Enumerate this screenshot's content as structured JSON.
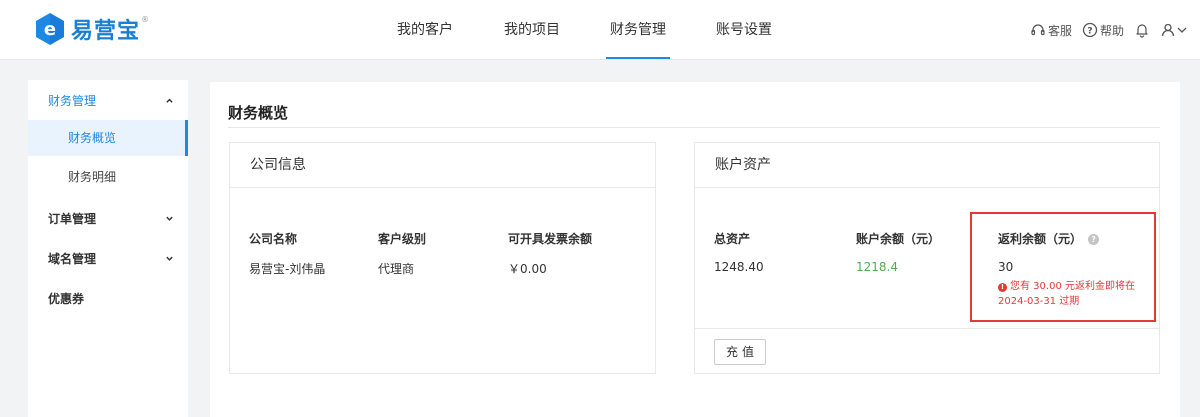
{
  "brand": {
    "name": "易营宝",
    "reg_mark": "®",
    "accent": "#1e88e5"
  },
  "nav": {
    "items": [
      {
        "label": "我的客户"
      },
      {
        "label": "我的项目"
      },
      {
        "label": "财务管理",
        "active": true
      },
      {
        "label": "账号设置"
      }
    ]
  },
  "header_right": {
    "service": "客服",
    "help": "帮助"
  },
  "sidebar": {
    "groups": [
      {
        "label": "财务管理",
        "open": true,
        "items": [
          {
            "label": "财务概览",
            "active": true
          },
          {
            "label": "财务明细"
          }
        ]
      },
      {
        "label": "订单管理"
      },
      {
        "label": "域名管理"
      },
      {
        "label": "优惠券"
      }
    ]
  },
  "main": {
    "title": "财务概览",
    "company": {
      "header": "公司信息",
      "columns": [
        "公司名称",
        "客户级别",
        "可开具发票余额"
      ],
      "values": [
        "易营宝-刘伟晶",
        "代理商",
        "￥0.00"
      ]
    },
    "assets": {
      "header": "账户资产",
      "columns": [
        "总资产",
        "账户余额（元）",
        "返利余额（元）"
      ],
      "values": [
        "1248.40",
        "1218.4",
        "30"
      ],
      "warning_line1": "您有 30.00 元返利金即将在",
      "warning_line2": "2024-03-31 过期",
      "recharge_label": "充值"
    }
  }
}
